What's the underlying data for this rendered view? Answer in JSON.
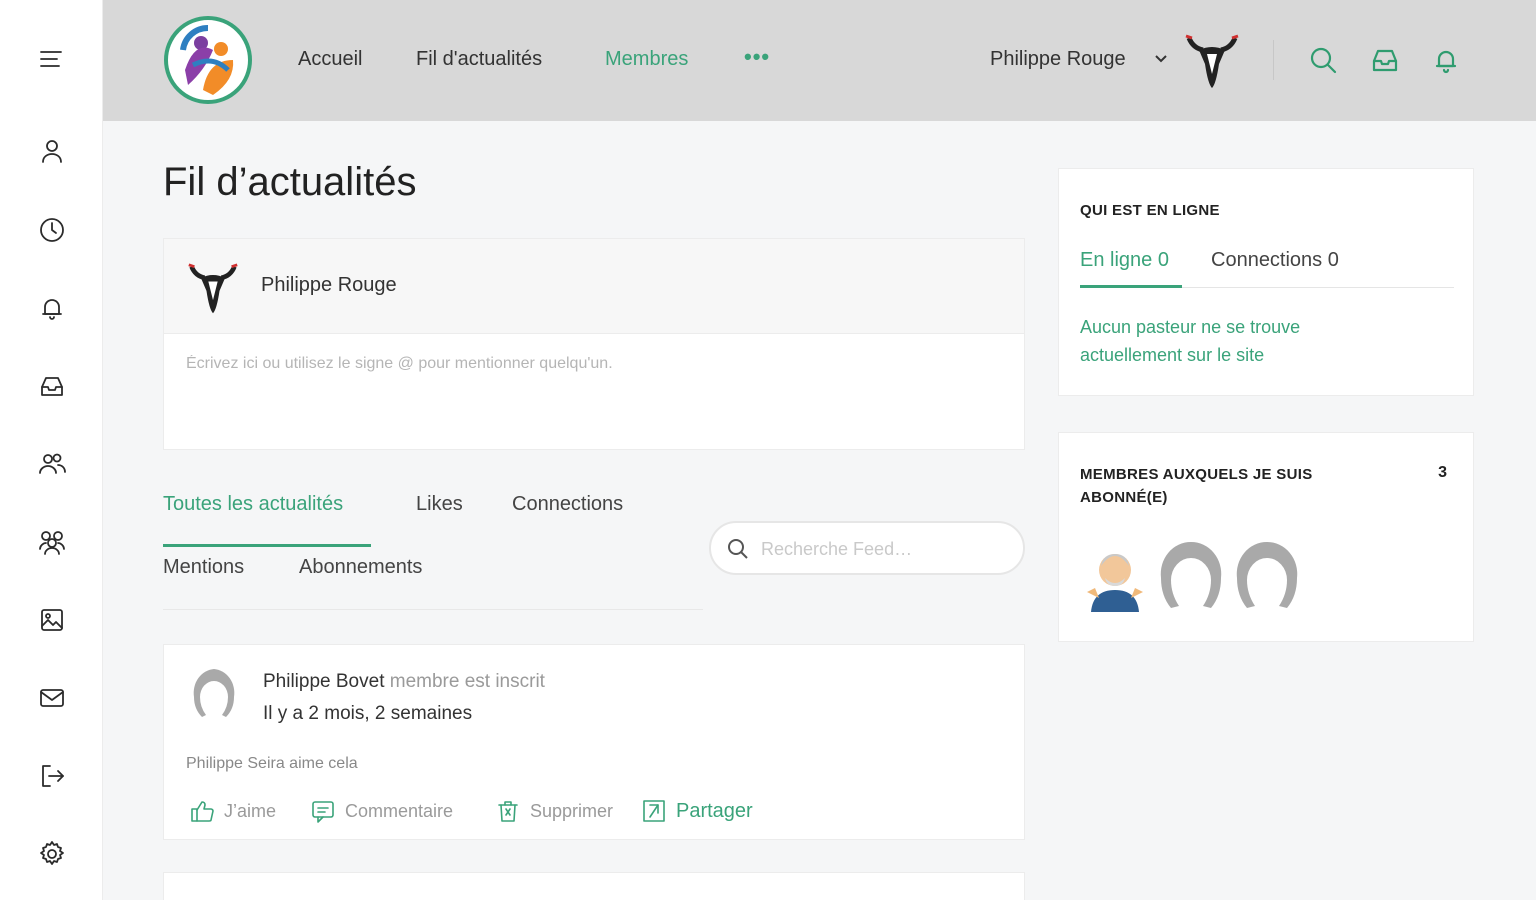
{
  "sidebar": {
    "icons": [
      "menu-icon",
      "profile-icon",
      "clock-icon",
      "bell-icon",
      "inbox-icon",
      "users-icon",
      "groups-icon",
      "photo-icon",
      "mail-icon",
      "logout-icon",
      "settings-icon"
    ]
  },
  "header": {
    "nav": [
      "Accueil",
      "Fil d'actualités",
      "Membres"
    ],
    "more": "•••",
    "user_name": "Philippe Rouge"
  },
  "main": {
    "title": "Fil d’actualités",
    "compose": {
      "user_name": "Philippe Rouge",
      "placeholder": "Écrivez ici ou utilisez le signe @ pour mentionner quelqu'un."
    },
    "tabs": [
      "Toutes les actualités",
      "Likes",
      "Connections",
      "Mentions",
      "Abonnements"
    ],
    "search_placeholder": "Recherche Feed…",
    "activity": {
      "author": "Philippe Bovet",
      "action": "membre est inscrit",
      "time": "Il y a 2 mois, 2 semaines",
      "likes": "Philippe Seira aime cela",
      "buttons": [
        "J’aime",
        "Commentaire",
        "Supprimer",
        "Partager"
      ]
    }
  },
  "widgets": {
    "online": {
      "title": "QUI EST EN LIGNE",
      "tab_online": "En ligne 0",
      "tab_connections": "Connections 0",
      "message": "Aucun pasteur ne se trouve actuellement sur le site"
    },
    "following": {
      "title_line1": "MEMBRES AUXQUELS JE SUIS",
      "title_line2": "ABONNÉ(E)",
      "count": "3"
    }
  },
  "colors": {
    "accent": "#3aa37a",
    "header_bg": "#d8d8d8",
    "page_bg": "#f5f6f7"
  }
}
